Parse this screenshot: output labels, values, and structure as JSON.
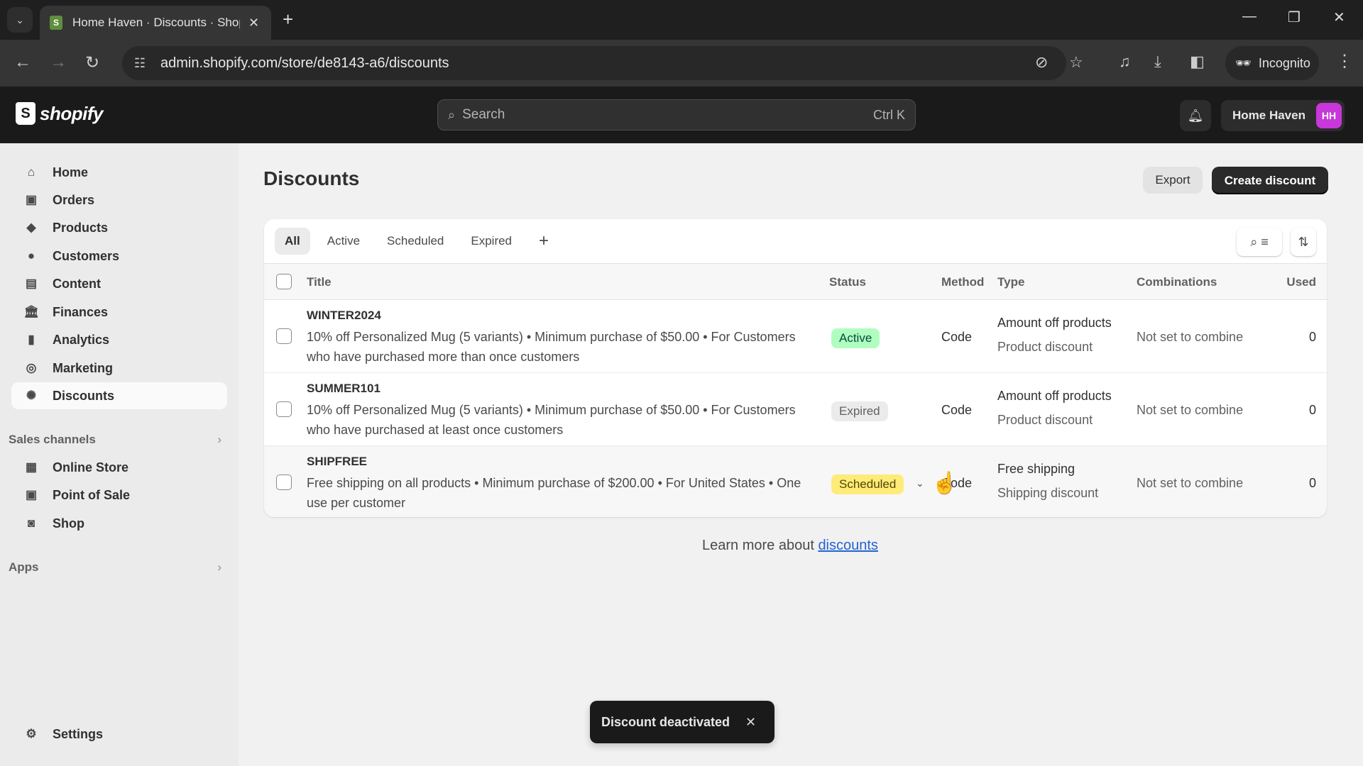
{
  "browser": {
    "tab_title": "Home Haven · Discounts · Shop",
    "favicon_letter": "S",
    "url": "admin.shopify.com/store/de8143-a6/discounts",
    "incognito_label": "Incognito"
  },
  "topbar": {
    "logo_text": "shopify",
    "logo_glyph": "S",
    "search_placeholder": "Search",
    "search_shortcut": "Ctrl K",
    "store_name": "Home Haven",
    "avatar_initials": "HH"
  },
  "sidebar": {
    "items": [
      {
        "label": "Home",
        "icon": "home-icon"
      },
      {
        "label": "Orders",
        "icon": "inbox-icon"
      },
      {
        "label": "Products",
        "icon": "tag-icon"
      },
      {
        "label": "Customers",
        "icon": "person-icon"
      },
      {
        "label": "Content",
        "icon": "image-icon"
      },
      {
        "label": "Finances",
        "icon": "bank-icon"
      },
      {
        "label": "Analytics",
        "icon": "bar-chart-icon"
      },
      {
        "label": "Marketing",
        "icon": "target-icon"
      },
      {
        "label": "Discounts",
        "icon": "discount-icon",
        "selected": true
      }
    ],
    "sales_channels_header": "Sales channels",
    "sales_channels": [
      {
        "label": "Online Store",
        "icon": "store-icon"
      },
      {
        "label": "Point of Sale",
        "icon": "pos-icon"
      },
      {
        "label": "Shop",
        "icon": "shop-icon"
      }
    ],
    "apps_header": "Apps",
    "settings_label": "Settings"
  },
  "main": {
    "title": "Discounts",
    "export_label": "Export",
    "create_label": "Create discount",
    "filter_tabs": [
      "All",
      "Active",
      "Scheduled",
      "Expired"
    ],
    "selected_tab": "All",
    "columns": {
      "title": "Title",
      "status": "Status",
      "method": "Method",
      "type": "Type",
      "combinations": "Combinations",
      "used": "Used"
    },
    "rows": [
      {
        "title": "WINTER2024",
        "description": "10% off Personalized Mug (5 variants) • Minimum purchase of $50.00 • For Customers who have purchased more than once customers",
        "status": "Active",
        "method": "Code",
        "type": "Amount off products",
        "type_sub": "Product discount",
        "combinations": "Not set to combine",
        "used": "0"
      },
      {
        "title": "SUMMER101",
        "description": "10% off Personalized Mug (5 variants) • Minimum purchase of $50.00 • For Customers who have purchased at least once customers",
        "status": "Expired",
        "method": "Code",
        "type": "Amount off products",
        "type_sub": "Product discount",
        "combinations": "Not set to combine",
        "used": "0"
      },
      {
        "title": "SHIPFREE",
        "description": "Free shipping on all products • Minimum purchase of $200.00 • For United States • One use per customer",
        "status": "Scheduled",
        "method": "Code",
        "type": "Free shipping",
        "type_sub": "Shipping discount",
        "combinations": "Not set to combine",
        "used": "0"
      }
    ],
    "learn_more_prefix": "Learn more about ",
    "learn_more_link": "discounts"
  },
  "toast": {
    "message": "Discount deactivated"
  },
  "colors": {
    "active_badge": "#affebf",
    "scheduled_badge": "#ffeb78",
    "expired_badge": "#ebebeb",
    "avatar": "#c837d9",
    "link": "#2463d4"
  }
}
